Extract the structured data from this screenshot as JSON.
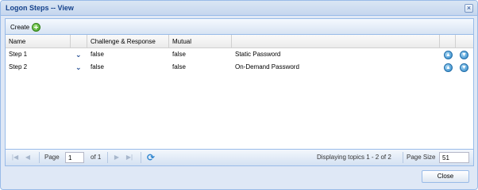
{
  "window": {
    "title": "Logon Steps -- View"
  },
  "toolbar": {
    "create_label": "Create"
  },
  "columns": [
    "Name",
    "",
    "Challenge & Response",
    "Mutual",
    ""
  ],
  "rows": [
    {
      "name": "Step 1",
      "challenge": "false",
      "mutual": "false",
      "description": "Static Password"
    },
    {
      "name": "Step 2",
      "challenge": "false",
      "mutual": "false",
      "description": "On-Demand Password"
    }
  ],
  "pager": {
    "page_label": "Page",
    "page_value": "1",
    "of_label": "of 1",
    "display_text": "Displaying topics 1 - 2 of 2",
    "page_size_label": "Page Size",
    "page_size_value": "51"
  },
  "footer": {
    "close_label": "Close"
  },
  "colors": {
    "accent": "#15428b",
    "border": "#99bbe8"
  }
}
